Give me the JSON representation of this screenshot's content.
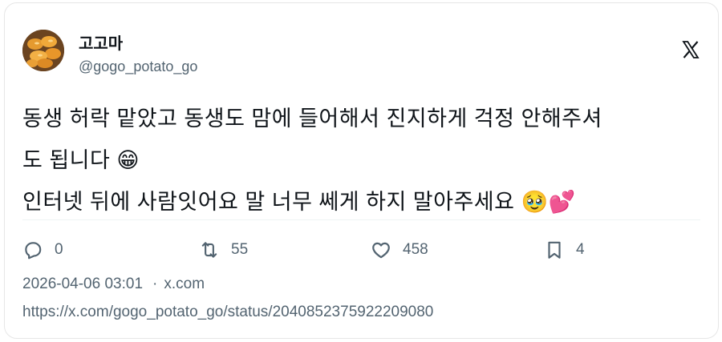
{
  "author": {
    "display_name": "고고마",
    "handle": "@gogo_potato_go",
    "avatar_icon": "avatar-fried-snacks"
  },
  "platform_icon": "x-logo-icon",
  "tweet": {
    "lines": [
      "동생 허락 맡았고 동생도 맘에 들어해서 진지하게 걱정 안해주셔",
      "도 됩니다 😁",
      "인터넷 뒤에 사람잇어요 말 너무 쎄게 하지 말아주세요 🥹💕"
    ]
  },
  "stats": {
    "replies": "0",
    "reposts": "55",
    "likes": "458",
    "bookmarks": "4"
  },
  "meta": {
    "timestamp": "2026-04-06 03:01",
    "separator": "·",
    "source": "x.com"
  },
  "url": "https://x.com/gogo_potato_go/status/2040852375922209080",
  "colors": {
    "text": "#0f1419",
    "muted": "#536471",
    "border": "#e6e6e6"
  }
}
